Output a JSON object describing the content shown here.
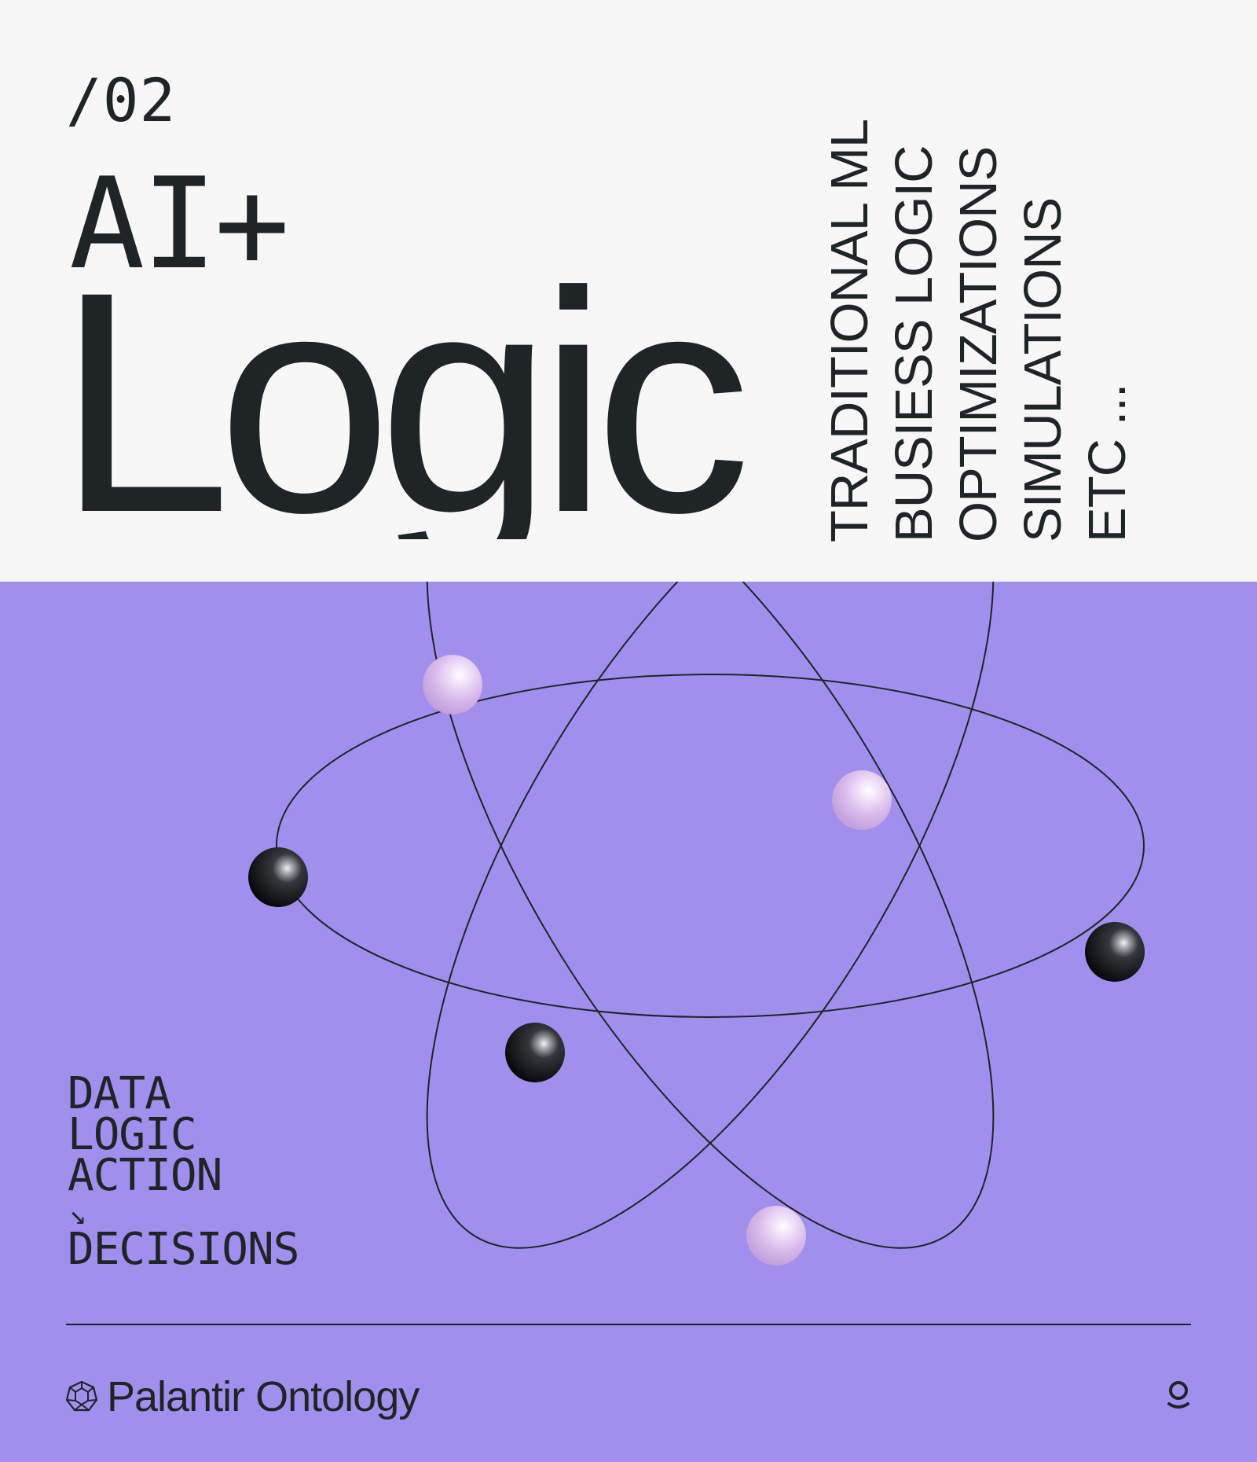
{
  "page": {
    "number": "/02",
    "headline_small": "AI+",
    "headline_large": "Logic"
  },
  "vertical_list": [
    "TRADITIONAL ML",
    "BUSIESS LOGIC",
    "OPTIMIZATIONS",
    "SIMULATIONS",
    "ETC ..."
  ],
  "flow": {
    "items": [
      "DATA",
      "LOGIC",
      "ACTION"
    ],
    "arrow": "↘",
    "result": "DECISIONS"
  },
  "brand": {
    "name": "Palantir Ontology"
  },
  "colors": {
    "top_background": "#f7f7f7",
    "bottom_background": "#a08fec",
    "ink": "#1f2427",
    "sphere_dark": "#111517",
    "sphere_light": "#d7b8ea"
  }
}
